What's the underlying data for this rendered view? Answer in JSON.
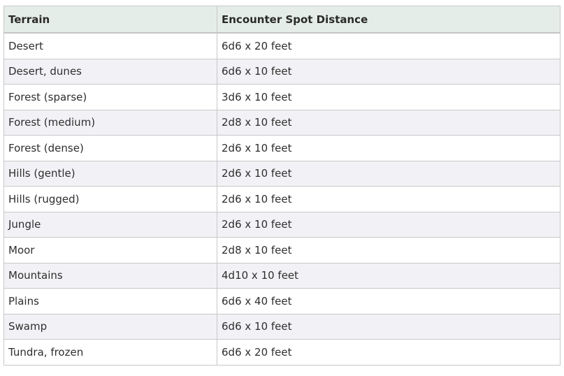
{
  "table": {
    "headers": [
      "Terrain",
      "Encounter Spot Distance"
    ],
    "rows": [
      [
        "Desert",
        "6d6 x 20 feet"
      ],
      [
        "Desert, dunes",
        "6d6 x 10 feet"
      ],
      [
        "Forest (sparse)",
        "3d6 x 10 feet"
      ],
      [
        "Forest (medium)",
        "2d8 x 10 feet"
      ],
      [
        "Forest (dense)",
        "2d6 x 10 feet"
      ],
      [
        "Hills (gentle)",
        "2d6 x 10 feet"
      ],
      [
        "Hills (rugged)",
        "2d6 x 10 feet"
      ],
      [
        "Jungle",
        "2d6 x 10 feet"
      ],
      [
        "Moor",
        "2d8 x 10 feet"
      ],
      [
        "Mountains",
        "4d10 x 10 feet"
      ],
      [
        "Plains",
        "6d6 x 40 feet"
      ],
      [
        "Swamp",
        "6d6 x 10 feet"
      ],
      [
        "Tundra, frozen",
        "6d6 x 20 feet"
      ]
    ]
  }
}
